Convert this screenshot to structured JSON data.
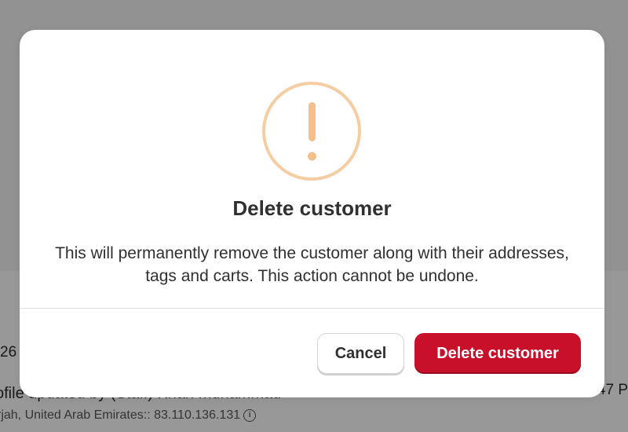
{
  "background": {
    "left_partial_value": "26",
    "right_partial_value": ":47 P",
    "event_line": "ofile updated by (Staff) Khan muhammad",
    "event_location": "rjah, United Arab Emirates:: 83.110.136.131",
    "info_icon_glyph": "i"
  },
  "modal": {
    "icon": "warning-exclamation-icon",
    "icon_color": "#f6cda2",
    "title": "Delete customer",
    "message": "This will permanently remove the customer along with their addresses, tags and carts. This action cannot be undone.",
    "cancel_label": "Cancel",
    "delete_label": "Delete customer",
    "delete_color": "#c9102a"
  }
}
